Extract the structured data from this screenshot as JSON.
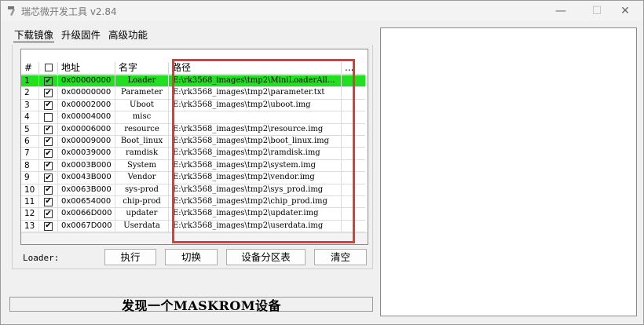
{
  "window": {
    "title": "瑞芯微开发工具 v2.84",
    "app_icon": "hammer-icon",
    "controls": {
      "minimize": "—",
      "maximize": "☐",
      "close": "✕"
    }
  },
  "tabs": [
    {
      "label": "下载镜像",
      "active": true
    },
    {
      "label": "升级固件",
      "active": false
    },
    {
      "label": "高级功能",
      "active": false
    }
  ],
  "table": {
    "headers": {
      "num": "#",
      "addr": "地址",
      "name": "名字",
      "path": "路径",
      "extra": "..."
    },
    "rows": [
      {
        "num": "1",
        "checked": "✔",
        "addr": "0x00000000",
        "name": "Loader",
        "path": "E:\\rk3568_images\\tmp2\\MiniLoaderAll..."
      },
      {
        "num": "2",
        "checked": "✔",
        "addr": "0x00000000",
        "name": "Parameter",
        "path": "E:\\rk3568_images\\tmp2\\parameter.txt"
      },
      {
        "num": "3",
        "checked": "✔",
        "addr": "0x00002000",
        "name": "Uboot",
        "path": "E:\\rk3568_images\\tmp2\\uboot.img"
      },
      {
        "num": "4",
        "checked": "",
        "addr": "0x00004000",
        "name": "misc",
        "path": ""
      },
      {
        "num": "5",
        "checked": "✔",
        "addr": "0x00006000",
        "name": "resource",
        "path": "E:\\rk3568_images\\tmp2\\resource.img"
      },
      {
        "num": "6",
        "checked": "✔",
        "addr": "0x00009000",
        "name": "Boot_linux",
        "path": "E:\\rk3568_images\\tmp2\\boot_linux.img"
      },
      {
        "num": "7",
        "checked": "✔",
        "addr": "0x00039000",
        "name": "ramdisk",
        "path": "E:\\rk3568_images\\tmp2\\ramdisk.img"
      },
      {
        "num": "8",
        "checked": "✔",
        "addr": "0x0003B000",
        "name": "System",
        "path": "E:\\rk3568_images\\tmp2\\system.img"
      },
      {
        "num": "9",
        "checked": "✔",
        "addr": "0x0043B000",
        "name": "Vendor",
        "path": "E:\\rk3568_images\\tmp2\\vendor.img"
      },
      {
        "num": "10",
        "checked": "✔",
        "addr": "0x0063B000",
        "name": "sys-prod",
        "path": "E:\\rk3568_images\\tmp2\\sys_prod.img"
      },
      {
        "num": "11",
        "checked": "✔",
        "addr": "0x00654000",
        "name": "chip-prod",
        "path": "E:\\rk3568_images\\tmp2\\chip_prod.img"
      },
      {
        "num": "12",
        "checked": "✔",
        "addr": "0x0066D000",
        "name": "updater",
        "path": "E:\\rk3568_images\\tmp2\\updater.img"
      },
      {
        "num": "13",
        "checked": "✔",
        "addr": "0x0067D000",
        "name": "Userdata",
        "path": "E:\\rk3568_images\\tmp2\\userdata.img"
      }
    ]
  },
  "loader_label": "Loader:",
  "buttons": {
    "execute": "执行",
    "switch": "切换",
    "partition_table": "设备分区表",
    "clear": "清空"
  },
  "status": "发现一个MASKROM设备",
  "colors": {
    "selected_row": "#20e020",
    "highlight_box": "#e53935"
  }
}
